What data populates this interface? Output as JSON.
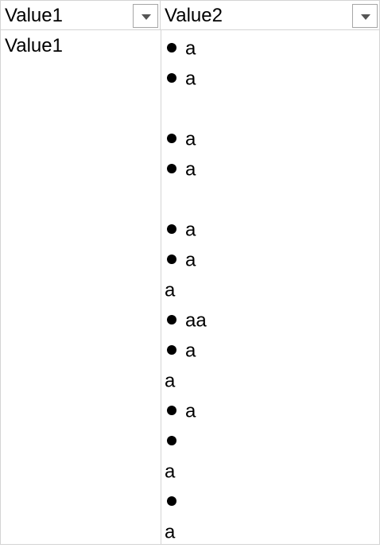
{
  "headers": {
    "col1": "Value1",
    "col2": "Value2"
  },
  "rows": {
    "col1_value": "Value1",
    "col2_lines": [
      {
        "bullet": true,
        "text": "a"
      },
      {
        "bullet": true,
        "text": "a"
      },
      {
        "bullet": false,
        "text": ""
      },
      {
        "bullet": true,
        "text": "a"
      },
      {
        "bullet": true,
        "text": "a"
      },
      {
        "bullet": false,
        "text": ""
      },
      {
        "bullet": true,
        "text": "a"
      },
      {
        "bullet": true,
        "text": "a"
      },
      {
        "bullet": false,
        "text": "a"
      },
      {
        "bullet": true,
        "text": "aa"
      },
      {
        "bullet": true,
        "text": "a"
      },
      {
        "bullet": false,
        "text": "a"
      },
      {
        "bullet": true,
        "text": "a"
      },
      {
        "bullet": true,
        "text": ""
      },
      {
        "bullet": false,
        "text": "a"
      },
      {
        "bullet": true,
        "text": ""
      },
      {
        "bullet": false,
        "text": "a"
      }
    ]
  },
  "icons": {
    "filter": "dropdown-arrow-icon",
    "bullet": "bullet-icon"
  },
  "colors": {
    "grid_line": "#d4d4d4",
    "filter_border": "#a6a6a6",
    "filter_arrow": "#555555"
  }
}
